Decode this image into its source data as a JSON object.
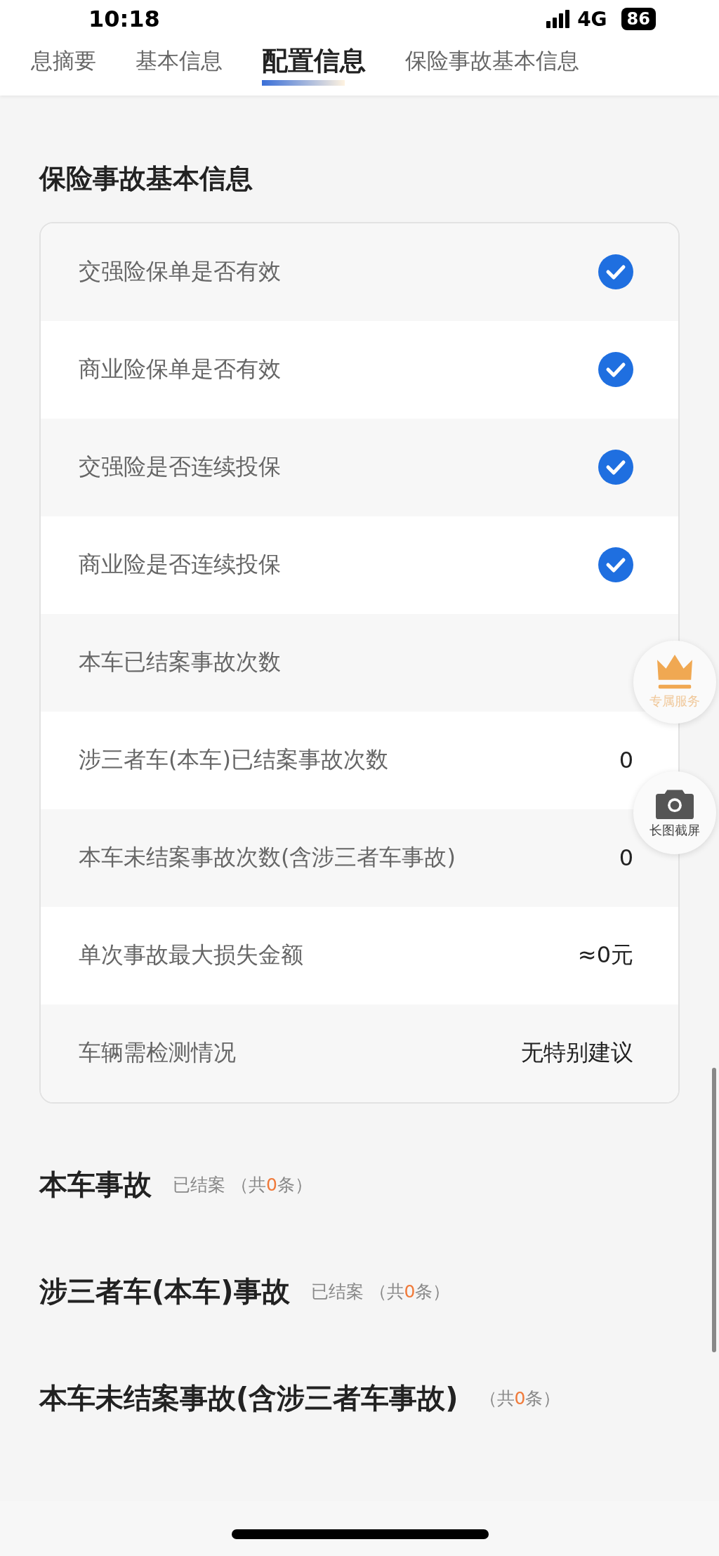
{
  "status_bar": {
    "time": "10:18",
    "network": "4G",
    "battery": "86"
  },
  "tabs": [
    {
      "label": "息摘要",
      "selected": false
    },
    {
      "label": "基本信息",
      "selected": false
    },
    {
      "label": "配置信息",
      "selected": true
    },
    {
      "label": "保险事故基本信息",
      "selected": false
    }
  ],
  "section_title": "保险事故基本信息",
  "rows": [
    {
      "label": "交强险保单是否有效",
      "kind": "check",
      "checked": true
    },
    {
      "label": "商业险保单是否有效",
      "kind": "check",
      "checked": true
    },
    {
      "label": "交强险是否连续投保",
      "kind": "check",
      "checked": true
    },
    {
      "label": "商业险是否连续投保",
      "kind": "check",
      "checked": true
    },
    {
      "label": "本车已结案事故次数",
      "kind": "text"
    },
    {
      "label": "涉三者车(本车)已结案事故次数",
      "kind": "text",
      "value": "0"
    },
    {
      "label": "本车未结案事故次数(含涉三者车事故)",
      "kind": "text",
      "value": "0"
    },
    {
      "label": "单次事故最大损失金额",
      "kind": "text",
      "value": "≈0元"
    },
    {
      "label": "车辆需检测情况",
      "kind": "text",
      "value": "无特别建议"
    }
  ],
  "accident_sections": [
    {
      "title": "本车事故",
      "pre": "已结案 （共",
      "count": "0",
      "post": "条）"
    },
    {
      "title": "涉三者车(本车)事故",
      "pre": "已结案 （共",
      "count": "0",
      "post": "条）"
    },
    {
      "title": "本车未结案事故(含涉三者车事故)",
      "pre": "（共",
      "count": "0",
      "post": "条）"
    }
  ],
  "floating_buttons": [
    {
      "kind": "crown",
      "label": "专属服务"
    },
    {
      "kind": "camera",
      "label": "长图截屏"
    }
  ]
}
